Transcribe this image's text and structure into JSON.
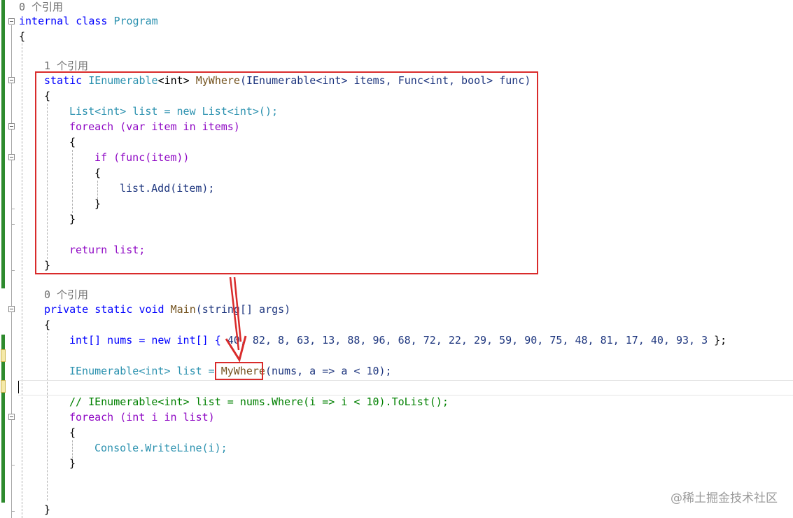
{
  "editor": {
    "ref_counts": {
      "class_refs": "0 个引用",
      "mywhere_refs": "1 个引用",
      "main_refs": "0 个引用"
    },
    "class_decl": {
      "kw_internal": "internal",
      "kw_class": "class",
      "name": "Program"
    },
    "lines": {
      "open_brace_class": "{",
      "open_brace": "{",
      "close_brace": "}"
    },
    "mywhere": {
      "kw_static": "static",
      "ret_type": "IEnumerable",
      "ret_generic": "<int>",
      "name": "MyWhere",
      "params": "(IEnumerable<int> items, Func<int, bool> func)",
      "list_decl": "List<int> list = new List<int>();",
      "foreach_line": "foreach (var item in items)",
      "if_line": "if (func(item))",
      "add_line": "list.Add(item);",
      "return_line": "return list;"
    },
    "main": {
      "signature_kw": "private static void",
      "name": "Main",
      "params": "(string[] args)",
      "nums_line_prefix": "int[] nums = new int[] {",
      "nums_values": "40, 82, 8, 63, 13, 88, 96, 68, 72, 22, 29, 59, 90, 75, 48, 81, 17, 40, 93, 3",
      "nums_line_suffix": "};",
      "list_line_prefix": "IEnumerable<int> list =",
      "list_line_call": "MyWhere",
      "list_line_suffix": "(nums, a => a < 10);",
      "comment_line": "// IEnumerable<int> list = nums.Where(i => i < 10).ToList();",
      "foreach_line": "foreach (int i in list)",
      "console_line": "Console.WriteLine(i);"
    }
  },
  "watermark": "@稀土掘金技术社区",
  "colors": {
    "annotation_red": "#d92b2b",
    "gutter_green": "#2d8a2d",
    "keyword_blue": "#0000ff",
    "type_teal": "#2b91af",
    "control_purple": "#8f08c4",
    "comment_green": "#008000"
  }
}
